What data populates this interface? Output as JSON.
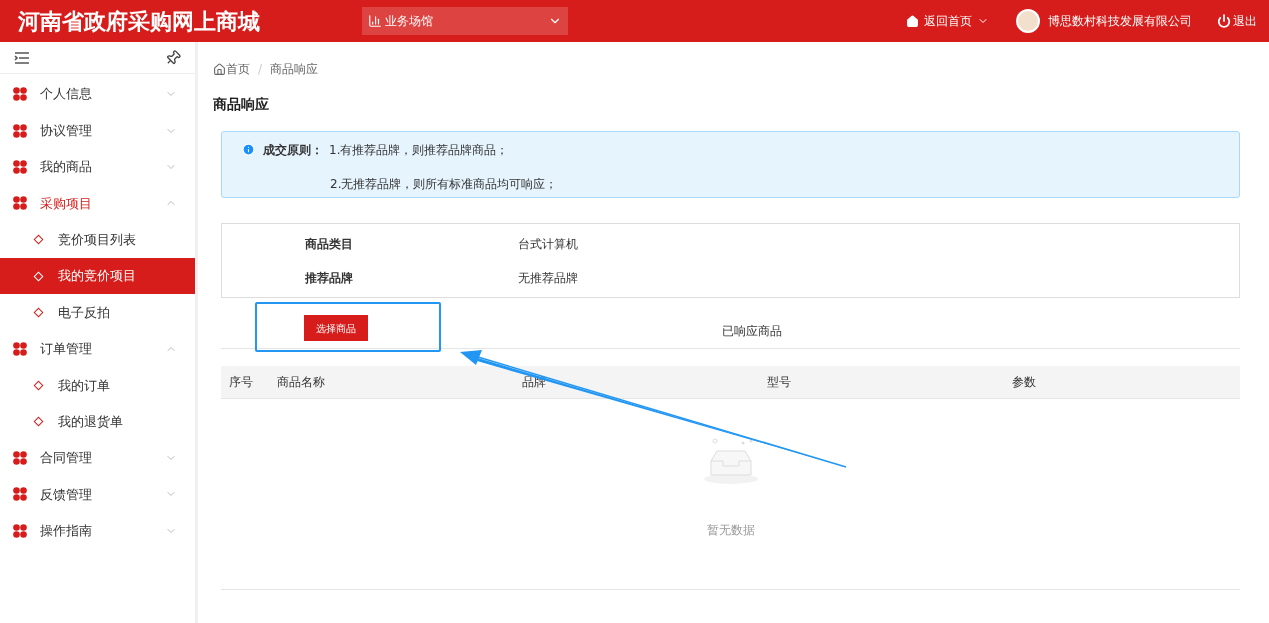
{
  "header": {
    "title": "河南省政府采购网上商城",
    "venue_select": {
      "value": "业务场馆"
    },
    "home_link": "返回首页",
    "company": "博思数村科技发展有限公司",
    "logout": "退出"
  },
  "sidebar": {
    "items": [
      {
        "label": "个人信息",
        "expanded": false,
        "selected": false
      },
      {
        "label": "协议管理",
        "expanded": false,
        "selected": false
      },
      {
        "label": "我的商品",
        "expanded": false,
        "selected": false
      },
      {
        "label": "采购项目",
        "expanded": true,
        "selected": true,
        "children": [
          {
            "label": "竞价项目列表",
            "selected": false
          },
          {
            "label": "我的竞价项目",
            "selected": true
          },
          {
            "label": "电子反拍",
            "selected": false
          }
        ]
      },
      {
        "label": "订单管理",
        "expanded": true,
        "selected": false,
        "children": [
          {
            "label": "我的订单",
            "selected": false
          },
          {
            "label": "我的退货单",
            "selected": false
          }
        ]
      },
      {
        "label": "合同管理",
        "expanded": false,
        "selected": false
      },
      {
        "label": "反馈管理",
        "expanded": false,
        "selected": false
      },
      {
        "label": "操作指南",
        "expanded": false,
        "selected": false
      }
    ]
  },
  "breadcrumb": [
    "首页",
    "/",
    "商品响应"
  ],
  "page_title": "商品响应",
  "notice": {
    "label": "成交原则：",
    "lines": [
      "1.有推荐品牌，则推荐品牌商品；",
      "2.无推荐品牌，则所有标准商品均可响应；"
    ]
  },
  "info": [
    {
      "label": "商品类目",
      "value": "台式计算机"
    },
    {
      "label": "推荐品牌",
      "value": "无推荐品牌"
    }
  ],
  "select_button": "选择商品",
  "responded_tab": "已响应商品",
  "table": {
    "columns": [
      "序号",
      "商品名称",
      "品牌",
      "型号",
      "参数"
    ],
    "empty_text": "暂无数据"
  }
}
